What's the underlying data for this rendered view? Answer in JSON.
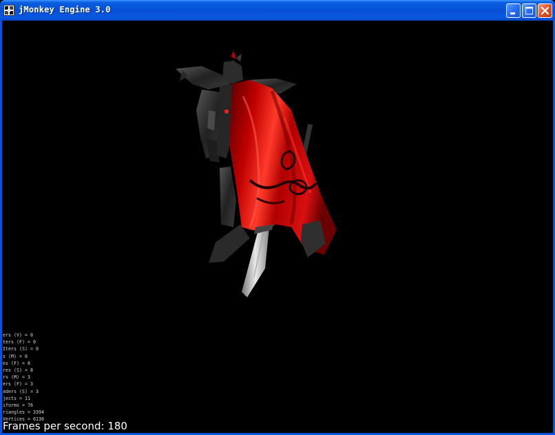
{
  "window": {
    "title": "jMonkey Engine 3.0",
    "controls": {
      "minimize_icon": "minimize-icon",
      "maximize_icon": "maximize-icon",
      "close_icon": "close-icon"
    },
    "colors": {
      "titlebar": "#0650d6",
      "close_button": "#e0512a",
      "viewport_background": "#000000",
      "cape": "#b80000"
    }
  },
  "viewport": {
    "stats": [
      "ers (V) = 0",
      "ters (F) = 0",
      "Iters (S) = 0",
      "s (M) = 0",
      "es (F) = 8",
      "res (S) = 8",
      "rs (M) = 3",
      "ers (F) = 3",
      "aders (S) = 3",
      "jects = 11",
      "iforms = 76",
      "riangles = 3394",
      "Vertices = 6130"
    ],
    "fps_label": "Frames per second: 180"
  }
}
